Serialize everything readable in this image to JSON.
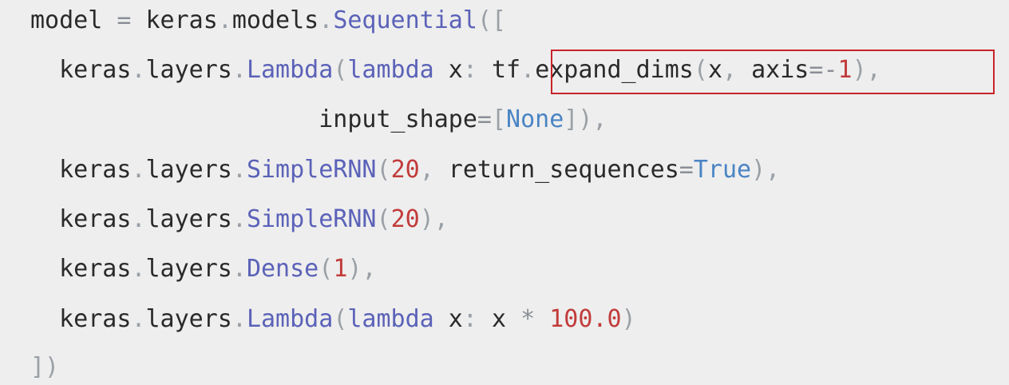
{
  "code": {
    "lines": [
      [
        {
          "t": "model",
          "k": "default"
        },
        {
          "t": " ",
          "k": "default"
        },
        {
          "t": "=",
          "k": "op"
        },
        {
          "t": " keras",
          "k": "default"
        },
        {
          "t": ".",
          "k": "punct"
        },
        {
          "t": "models",
          "k": "default"
        },
        {
          "t": ".",
          "k": "punct"
        },
        {
          "t": "Sequential",
          "k": "class"
        },
        {
          "t": "([",
          "k": "punct"
        }
      ],
      [
        {
          "t": "  keras",
          "k": "default"
        },
        {
          "t": ".",
          "k": "punct"
        },
        {
          "t": "layers",
          "k": "default"
        },
        {
          "t": ".",
          "k": "punct"
        },
        {
          "t": "Lambda",
          "k": "class"
        },
        {
          "t": "(",
          "k": "punct"
        },
        {
          "t": "lambda",
          "k": "keyword"
        },
        {
          "t": " x",
          "k": "default"
        },
        {
          "t": ":",
          "k": "punct"
        },
        {
          "t": " tf",
          "k": "default"
        },
        {
          "t": ".",
          "k": "punct"
        },
        {
          "t": "expand_dims",
          "k": "default"
        },
        {
          "t": "(",
          "k": "punct"
        },
        {
          "t": "x",
          "k": "default"
        },
        {
          "t": ",",
          "k": "punct"
        },
        {
          "t": " axis",
          "k": "default"
        },
        {
          "t": "=",
          "k": "op"
        },
        {
          "t": "-",
          "k": "op"
        },
        {
          "t": "1",
          "k": "number"
        },
        {
          "t": ")",
          "k": "punct"
        },
        {
          "t": ",",
          "k": "punct"
        }
      ],
      [
        {
          "t": "                    input_shape",
          "k": "default"
        },
        {
          "t": "=",
          "k": "op"
        },
        {
          "t": "[",
          "k": "punct"
        },
        {
          "t": "None",
          "k": "const"
        },
        {
          "t": "])",
          "k": "punct"
        },
        {
          "t": ",",
          "k": "punct"
        }
      ],
      [
        {
          "t": "  keras",
          "k": "default"
        },
        {
          "t": ".",
          "k": "punct"
        },
        {
          "t": "layers",
          "k": "default"
        },
        {
          "t": ".",
          "k": "punct"
        },
        {
          "t": "SimpleRNN",
          "k": "class"
        },
        {
          "t": "(",
          "k": "punct"
        },
        {
          "t": "20",
          "k": "number"
        },
        {
          "t": ",",
          "k": "punct"
        },
        {
          "t": " return_sequences",
          "k": "default"
        },
        {
          "t": "=",
          "k": "op"
        },
        {
          "t": "True",
          "k": "const"
        },
        {
          "t": ")",
          "k": "punct"
        },
        {
          "t": ",",
          "k": "punct"
        }
      ],
      [
        {
          "t": "  keras",
          "k": "default"
        },
        {
          "t": ".",
          "k": "punct"
        },
        {
          "t": "layers",
          "k": "default"
        },
        {
          "t": ".",
          "k": "punct"
        },
        {
          "t": "SimpleRNN",
          "k": "class"
        },
        {
          "t": "(",
          "k": "punct"
        },
        {
          "t": "20",
          "k": "number"
        },
        {
          "t": ")",
          "k": "punct"
        },
        {
          "t": ",",
          "k": "punct"
        }
      ],
      [
        {
          "t": "  keras",
          "k": "default"
        },
        {
          "t": ".",
          "k": "punct"
        },
        {
          "t": "layers",
          "k": "default"
        },
        {
          "t": ".",
          "k": "punct"
        },
        {
          "t": "Dense",
          "k": "class"
        },
        {
          "t": "(",
          "k": "punct"
        },
        {
          "t": "1",
          "k": "number"
        },
        {
          "t": ")",
          "k": "punct"
        },
        {
          "t": ",",
          "k": "punct"
        }
      ],
      [
        {
          "t": "  keras",
          "k": "default"
        },
        {
          "t": ".",
          "k": "punct"
        },
        {
          "t": "layers",
          "k": "default"
        },
        {
          "t": ".",
          "k": "punct"
        },
        {
          "t": "Lambda",
          "k": "class"
        },
        {
          "t": "(",
          "k": "punct"
        },
        {
          "t": "lambda",
          "k": "keyword"
        },
        {
          "t": " x",
          "k": "default"
        },
        {
          "t": ":",
          "k": "punct"
        },
        {
          "t": " x ",
          "k": "default"
        },
        {
          "t": "*",
          "k": "op"
        },
        {
          "t": " ",
          "k": "default"
        },
        {
          "t": "100.0",
          "k": "number"
        },
        {
          "t": ")",
          "k": "punct"
        }
      ],
      [
        {
          "t": "])",
          "k": "punct"
        }
      ]
    ]
  },
  "highlight": {
    "color": "#c8232a",
    "target_text": "tf.expand_dims(x, axis=-1)"
  },
  "colors": {
    "background": "#eeeeee",
    "text": "#2a2a2a",
    "punctuation": "#9aa0a6",
    "class_name": "#5b62b8",
    "keyword": "#5b62b8",
    "number": "#c23b3b",
    "constant": "#4a84c4"
  }
}
